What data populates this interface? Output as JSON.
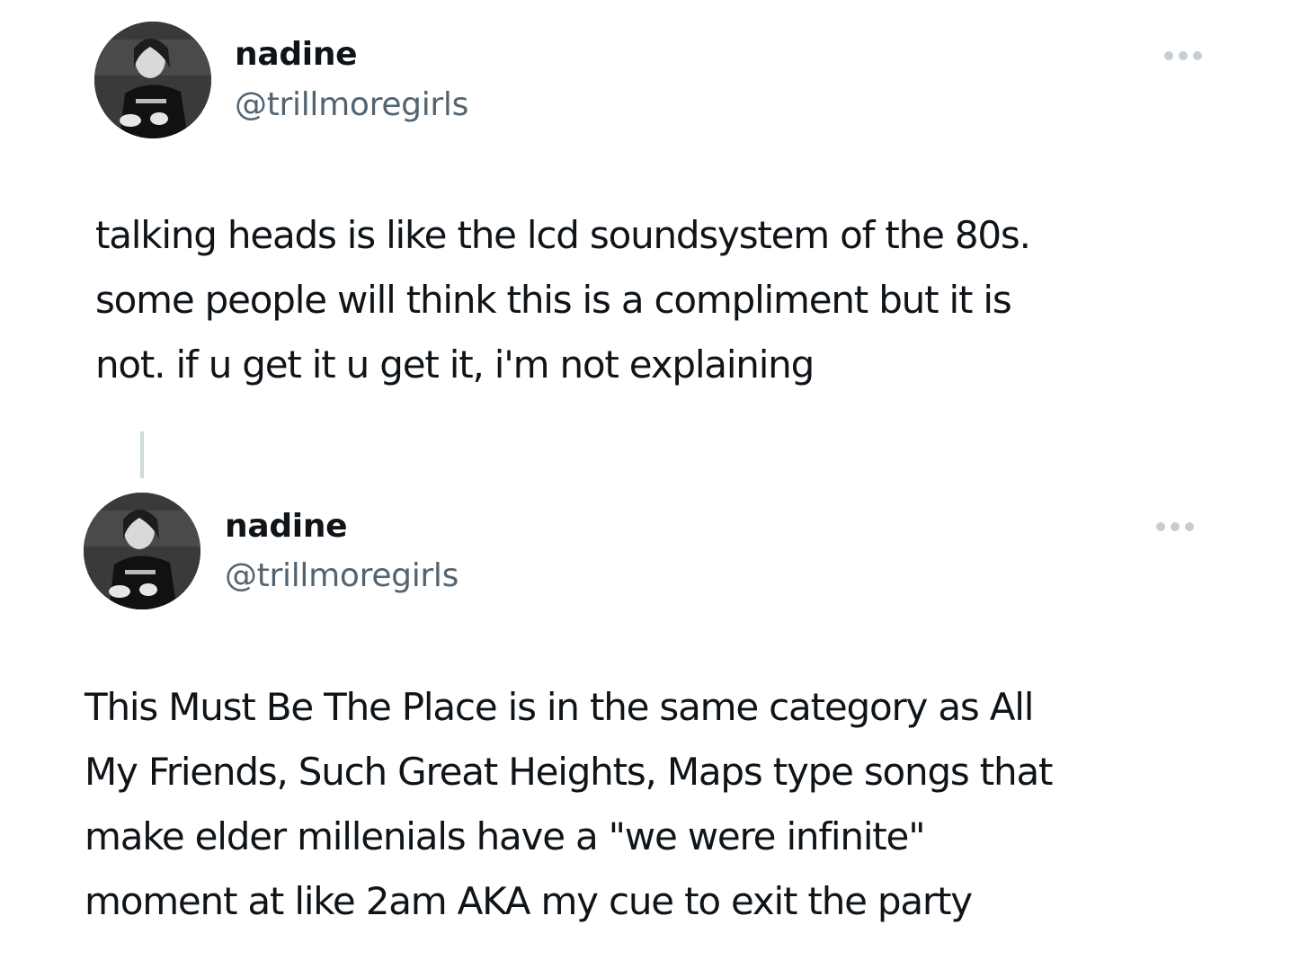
{
  "tweets": [
    {
      "display_name": "nadine",
      "handle": "@trillmoregirls",
      "avatar_icon": "profile-photo",
      "more_icon": "ellipsis-icon",
      "text_lines": [
        "talking heads is like the lcd soundsystem of the 80s.",
        "some people will think this is a compliment but it is",
        "not. if u get it u get it, i'm not explaining"
      ]
    },
    {
      "display_name": "nadine",
      "handle": "@trillmoregirls",
      "avatar_icon": "profile-photo",
      "more_icon": "ellipsis-icon",
      "text_lines": [
        "This Must Be The Place is in the same category as All",
        "My Friends, Such Great Heights, Maps type songs that",
        "make elder millenials have a \"we were infinite\"",
        "moment at like 2am AKA my cue to exit the party"
      ]
    }
  ],
  "colors": {
    "text_primary": "#0f1419",
    "text_secondary": "#536471",
    "thread_line": "#cfd9de",
    "more_dots": "#c4cdd4"
  }
}
